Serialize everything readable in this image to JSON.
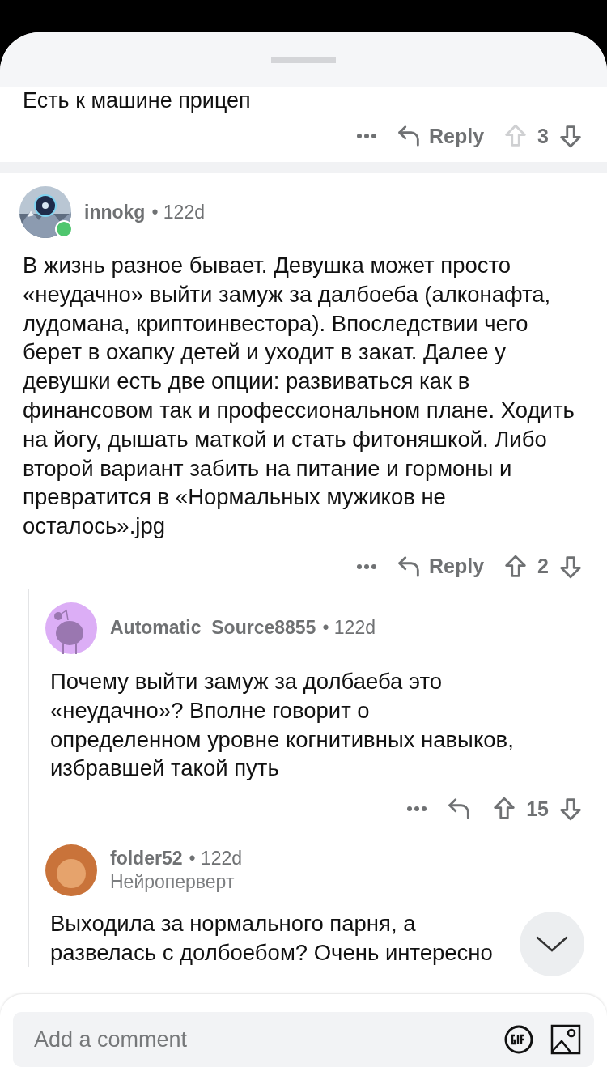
{
  "previous_comment": {
    "body_tail": "Есть к машине прицеп",
    "reply_label": "Reply",
    "score": "3"
  },
  "comments": [
    {
      "author": "innokg",
      "age": "• 122d",
      "online": true,
      "body": "В жизнь разное бывает. Девушка может просто «неудачно» выйти замуж за далбоеба (алконафта, лудомана, криптоинвестора). Впоследствии чего берет в охапку детей и уходит в закат. Далее у девушки есть две опции: развиваться как в финансовом так и профессиональном плане. Ходить на йогу, дышать маткой и стать фитоняшкой. Либо второй вариант забить на питание и гормоны и превратится в «Нормальных мужиков не осталось».jpg",
      "reply_label": "Reply",
      "score": "2",
      "children": [
        {
          "author": "Automatic_Source8855",
          "age": "• 122d",
          "kind": "snoo",
          "body": "Почему выйти замуж за долбаеба это «неудачно»? Вполне говорит о определенном уровне когнитивных навыков, избравшей такой путь",
          "score": "15"
        },
        {
          "author": "folder52",
          "age": "• 122d",
          "kind": "plain",
          "flair": "Нейроперверт",
          "body": "Выходила за нормального парня, а развелась с долбоебом? Очень интересно"
        }
      ]
    }
  ],
  "composer": {
    "placeholder": "Add a comment"
  }
}
